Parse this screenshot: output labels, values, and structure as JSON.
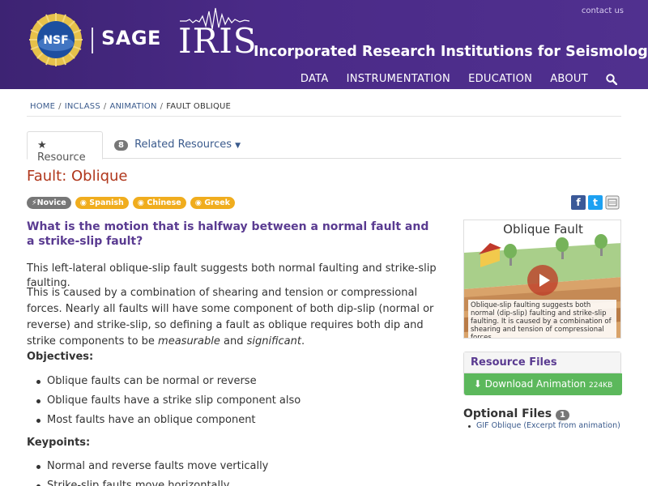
{
  "header": {
    "contact": "contact us",
    "nsf_text": "NSF",
    "sage": "SAGE",
    "iris": "IRIS",
    "iris_full": "Incorporated Research Institutions for Seismology",
    "nav": [
      "DATA",
      "INSTRUMENTATION",
      "EDUCATION",
      "ABOUT"
    ]
  },
  "breadcrumb": [
    "HOME",
    "INCLASS",
    "ANIMATION",
    "FAULT OBLIQUE"
  ],
  "tabs": {
    "resource": "Resource",
    "related_count": "8",
    "related": "Related Resources"
  },
  "title": "Fault: Oblique",
  "tags": [
    "Novice",
    "Spanish",
    "Chinese",
    "Greek"
  ],
  "share": {
    "facebook": "f",
    "twitter": "t"
  },
  "main": {
    "question": "What is the motion that is halfway between a normal fault and a strike-slip fault?",
    "p1": "This left-lateral oblique-slip fault suggests both normal faulting and strike-slip faulting.",
    "p2_start": "This is caused by a combination of shearing and tension or compressional forces. Nearly all faults will have some component of both dip-slip (normal or reverse) and strike-slip, so defining a fault as oblique requires both dip and strike components to be ",
    "p2_em1": "measurable",
    "p2_mid": " and ",
    "p2_em2": "significant",
    "p2_end": ".",
    "objectives_heading": "Objectives:",
    "objectives": [
      "Oblique faults can be normal or reverse",
      "Oblique faults have a strike slip component also",
      "Most faults have an oblique component"
    ],
    "keypoints_heading": "Keypoints:",
    "keypoints": [
      "Normal and reverse faults move vertically",
      "Strike-slip faults move horizontally"
    ]
  },
  "sidebar": {
    "video_title": "Oblique Fault",
    "video_caption": "Oblique-slip faulting suggests both normal (dip-slip) faulting and strike-slip faulting. It is caused by a combination of shearing and tension of compressional forces.",
    "resource_files": "Resource Files",
    "download": "Download Animation",
    "download_size": "224KB",
    "optional_files": "Optional Files",
    "optional_count": "1",
    "optional_items": [
      "GIF Oblique (Excerpt from animation)"
    ]
  },
  "colors": {
    "header": "#4a2a87",
    "title": "#b0371c",
    "question": "#5a3b91",
    "link": "#3a5a8c",
    "tag_orange": "#f0ad1e",
    "download": "#5cb85c"
  }
}
